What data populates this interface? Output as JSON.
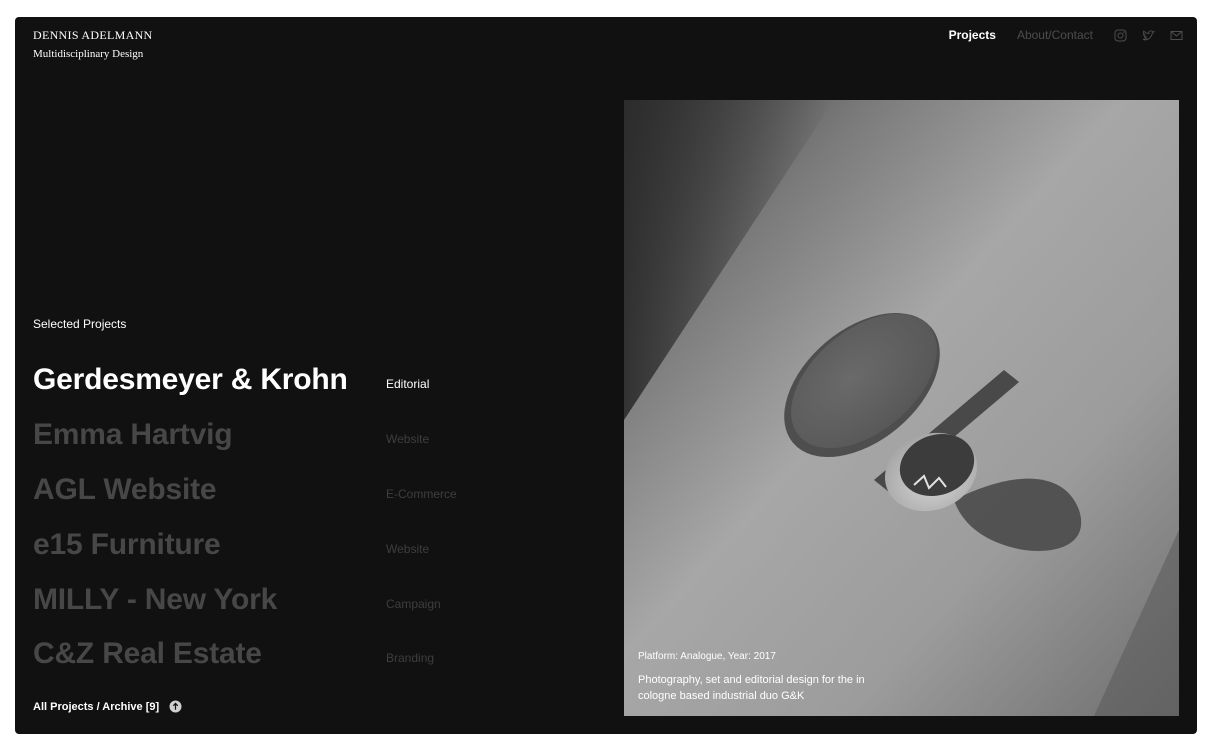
{
  "brand": {
    "name": "DENNIS ADELMANN",
    "subtitle": "Multidisciplinary Design"
  },
  "nav": {
    "projects": "Projects",
    "about": "About/Contact",
    "icons": [
      "instagram-icon",
      "twitter-icon",
      "mail-icon"
    ]
  },
  "section_label": "Selected Projects",
  "projects": [
    {
      "title": "Gerdesmeyer & Krohn",
      "tag": "Editorial",
      "active": true
    },
    {
      "title": "Emma Hartvig",
      "tag": "Website",
      "active": false
    },
    {
      "title": "AGL Website",
      "tag": "E-Commerce",
      "active": false
    },
    {
      "title": "e15 Furniture",
      "tag": "Website",
      "active": false
    },
    {
      "title": "MILLY - New York",
      "tag": "Campaign",
      "active": false
    },
    {
      "title": "C&Z Real Estate",
      "tag": "Branding",
      "active": false
    }
  ],
  "archive": {
    "label": "All Projects / Archive [9]",
    "icon": "arrow-up-circle-icon"
  },
  "feature": {
    "meta": "Platform: Analogue, Year: 2017",
    "description": "Photography, set and editorial design for the in cologne based industrial duo G&K"
  },
  "colors": {
    "background": "#111111",
    "active_text": "#ffffff",
    "inactive_title": "#474747",
    "inactive_tag": "#3e3e3e",
    "page": "#ffffff"
  }
}
